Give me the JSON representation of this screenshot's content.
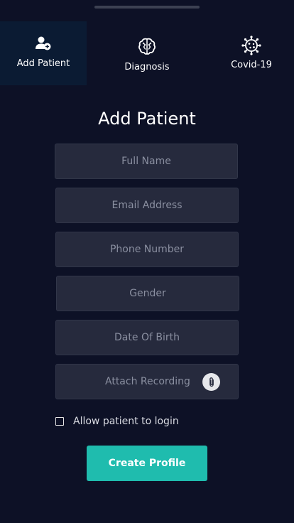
{
  "tabs": [
    {
      "label": "Add Patient",
      "icon": "add-user-icon",
      "active": true
    },
    {
      "label": "Diagnosis",
      "icon": "brain-icon",
      "active": false
    },
    {
      "label": "Covid-19",
      "icon": "virus-icon",
      "active": false
    }
  ],
  "form": {
    "title": "Add Patient",
    "full_name_placeholder": "Full Name",
    "email_placeholder": "Email Address",
    "phone_placeholder": "Phone Number",
    "gender_placeholder": "Gender",
    "dob_placeholder": "Date Of Birth",
    "attach_placeholder": "Attach Recording",
    "attach_icon": "paperclip-icon",
    "allow_login_label": "Allow patient to login",
    "allow_login_checked": false,
    "submit_label": "Create Profile"
  },
  "colors": {
    "background": "#0d1126",
    "active_tab": "#0b1b33",
    "field": "#262a3d",
    "accent": "#1fbcae"
  }
}
